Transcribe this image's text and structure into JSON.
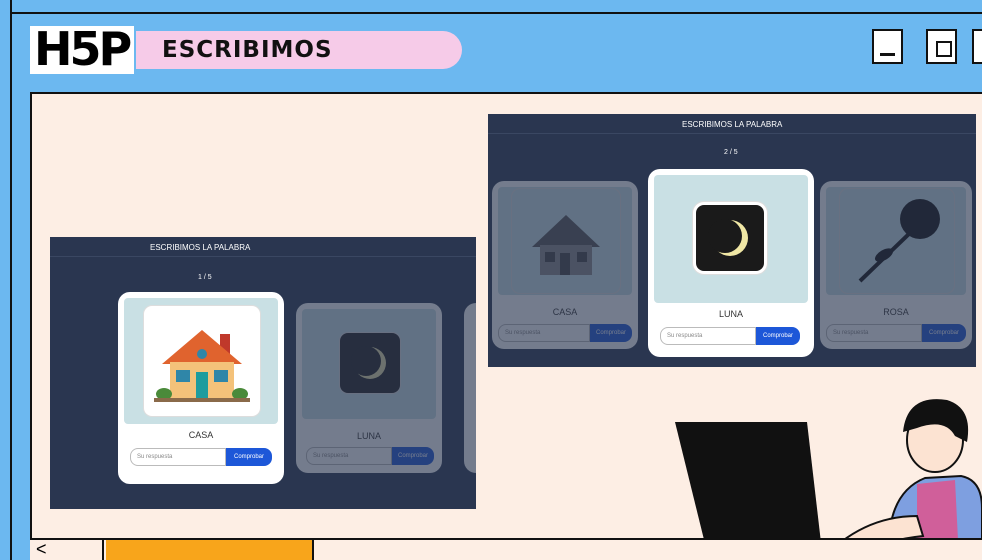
{
  "window": {
    "logo_text": "H5P",
    "title": "ESCRIBIMOS"
  },
  "panel_back": {
    "header": "ESCRIBIMOS LA PALABRA",
    "counter": "1 / 5",
    "cards": [
      {
        "word": "CASA",
        "placeholder": "Su respuesta",
        "button": "Comprobar"
      },
      {
        "word": "LUNA",
        "placeholder": "Su respuesta",
        "button": "Comprobar"
      }
    ]
  },
  "panel_front": {
    "header": "ESCRIBIMOS LA PALABRA",
    "counter": "2 / 5",
    "cards": [
      {
        "word": "CASA",
        "placeholder": "Su respuesta",
        "button": "Comprobar"
      },
      {
        "word": "LUNA",
        "placeholder": "Su respuesta",
        "button": "Comprobar"
      },
      {
        "word": "ROSA",
        "placeholder": "Su respuesta",
        "button": "Comprobar"
      }
    ]
  },
  "nav": {
    "back_glyph": "<"
  },
  "colors": {
    "frame": "#6cb8f0",
    "canvas": "#fdeee4",
    "panel": "#2a3650",
    "accent_button": "#1d57d8",
    "title_pill": "#f6cbe8",
    "orange_tab": "#f8a51b"
  }
}
